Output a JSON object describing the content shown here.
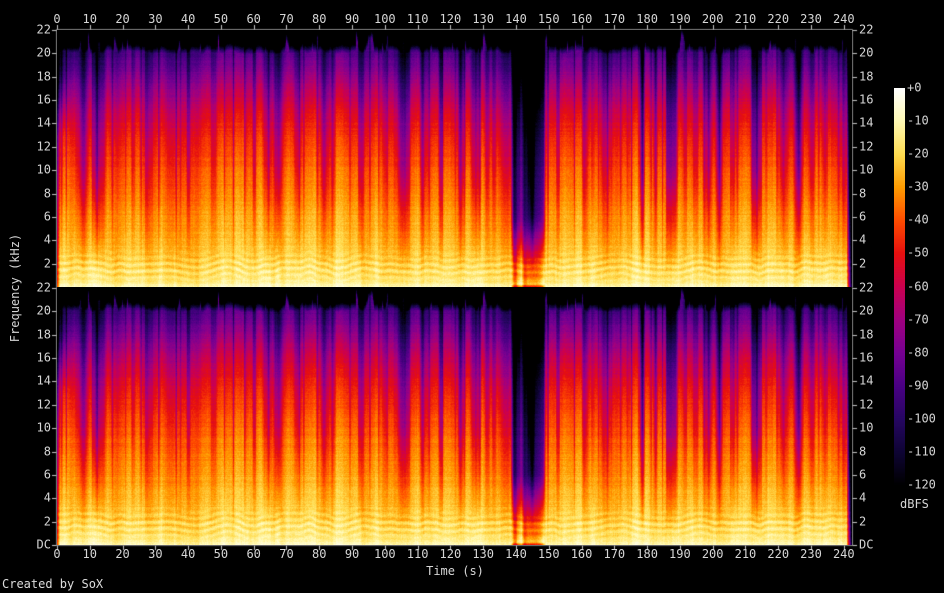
{
  "figure": {
    "credit": "Created by SoX",
    "background": "#000000",
    "label_color": "#d6d6d6"
  },
  "axes": {
    "x_label": "Time (s)",
    "y_label": "Frequency (kHz)",
    "time_tick_labels": [
      "0",
      "10",
      "20",
      "30",
      "40",
      "50",
      "60",
      "70",
      "80",
      "90",
      "100",
      "110",
      "120",
      "130",
      "140",
      "150",
      "160",
      "170",
      "180",
      "190",
      "200",
      "210",
      "220",
      "230",
      "240"
    ],
    "freq_tick_labels_top_panel": [
      "22",
      "20",
      "18",
      "16",
      "14",
      "12",
      "10",
      "8",
      "6",
      "4",
      "2"
    ],
    "freq_tick_labels_bottom_panel": [
      "22",
      "20",
      "18",
      "16",
      "14",
      "12",
      "10",
      "8",
      "6",
      "4",
      "2",
      "DC"
    ]
  },
  "colorbar": {
    "unit": "dBFS",
    "tick_labels": [
      "+0",
      "-10",
      "-20",
      "-30",
      "-40",
      "-50",
      "-60",
      "-70",
      "-80",
      "-90",
      "-100",
      "-110",
      "-120"
    ]
  },
  "chart_data": {
    "type": "heatmap",
    "subtype": "stereo audio spectrogram (SoX)",
    "panels": [
      "channel 1 (top)",
      "channel 2 (bottom)"
    ],
    "x_axis": {
      "label": "Time (s)",
      "min": 0,
      "max": 240,
      "tick_step": 10
    },
    "y_axis": {
      "label": "Frequency (kHz)",
      "min": 0,
      "max": 22,
      "tick_step": 2,
      "min_label": "DC"
    },
    "z_axis": {
      "label": "dBFS",
      "max": 0,
      "min": -120,
      "tick_step": 10
    },
    "palette_stops": [
      [
        0,
        "#ffffff"
      ],
      [
        -10,
        "#fff9b4"
      ],
      [
        -20,
        "#ffdc50"
      ],
      [
        -30,
        "#ff9b00"
      ],
      [
        -40,
        "#ff4b00"
      ],
      [
        -50,
        "#e60f0f"
      ],
      [
        -60,
        "#cb0050"
      ],
      [
        -70,
        "#a00080"
      ],
      [
        -80,
        "#760092"
      ],
      [
        -90,
        "#4a0084"
      ],
      [
        -100,
        "#260662"
      ],
      [
        -110,
        "#0e0434"
      ],
      [
        -120,
        "#000000"
      ]
    ],
    "features": {
      "duration_visible_s": 242,
      "lowpass_cutoff_khz": 20.1,
      "quiet_passage_s": [
        138,
        149
      ],
      "fade_out_end_s": [
        240.5,
        242
      ],
      "high_freq_rampup_end_s": 6,
      "avg_level_by_freq_dbfs": [
        [
          0,
          -7
        ],
        [
          0.2,
          -11
        ],
        [
          0.5,
          -15
        ],
        [
          1,
          -17
        ],
        [
          2,
          -19
        ],
        [
          3,
          -22
        ],
        [
          4,
          -25
        ],
        [
          6,
          -29
        ],
        [
          8,
          -33
        ],
        [
          10,
          -38
        ],
        [
          12,
          -43
        ],
        [
          14,
          -50
        ],
        [
          16,
          -60
        ],
        [
          17,
          -66
        ],
        [
          18,
          -73
        ],
        [
          19,
          -80
        ],
        [
          19.8,
          -86
        ],
        [
          22,
          -89
        ]
      ]
    }
  }
}
